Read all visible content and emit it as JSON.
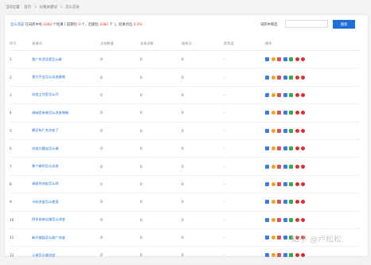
{
  "breadcrumb": {
    "items": [
      "当前位置：",
      "首页",
      "长尾关键词",
      "怎么凉皮"
    ],
    "separator": ">"
  },
  "summary": {
    "prefix": "怎么凉皮",
    "text1": " 在词库中有 ",
    "total": "4382",
    "text2": " 个结果 [ 前期包 ",
    "front": "0",
    "text3": " 个，后期包 ",
    "back": "4382",
    "text4": " 个 ]，结果点位 ",
    "rate": "0.0%"
  },
  "filter": {
    "label": "词库中筛选",
    "placeholder": "",
    "button_label": "搜索"
  },
  "columns": [
    "序号",
    "关键词",
    "文档数量",
    "长尾词数",
    "相关词",
    "竞争度",
    "操作"
  ],
  "rows": [
    {
      "no": "1",
      "keyword": "我广东西北套怎么做",
      "a": "0",
      "b": "0",
      "c": "0",
      "d": "-"
    },
    {
      "no": "2",
      "keyword": "我大平台怎么凉皮做做",
      "a": "0",
      "b": "0",
      "c": "0",
      "d": "-"
    },
    {
      "no": "3",
      "keyword": "凉皮工作室怎么开",
      "a": "0",
      "b": "0",
      "c": "0",
      "d": "-"
    },
    {
      "no": "4",
      "keyword": "调味西来做怎么凉皮做做",
      "a": "0",
      "b": "0",
      "c": "0",
      "d": "-"
    },
    {
      "no": "5",
      "keyword": "最近有广东凉皮了",
      "a": "0",
      "b": "0",
      "c": "0",
      "d": "-"
    },
    {
      "no": "6",
      "keyword": "凉皮分量该怎么做",
      "a": "0",
      "b": "0",
      "c": "0",
      "d": "-"
    },
    {
      "no": "7",
      "keyword": "哪个做的怎么凉皮",
      "a": "0",
      "b": "0",
      "c": "0",
      "d": "-"
    },
    {
      "no": "8",
      "keyword": "调面剂凉皮怎么样",
      "a": "0",
      "b": "0",
      "c": "0",
      "d": "-"
    },
    {
      "no": "9",
      "keyword": "卡料凉皮怎么使用",
      "a": "0",
      "b": "0",
      "c": "0",
      "d": "-"
    },
    {
      "no": "10",
      "keyword": "拼多多新店铺怎么凉皮",
      "a": "0",
      "b": "0",
      "c": "0",
      "d": "-"
    },
    {
      "no": "11",
      "keyword": "新开铺面怎么做广凉皮",
      "a": "0",
      "b": "0",
      "c": "0",
      "d": "-"
    },
    {
      "no": "12",
      "keyword": "小调怎么做凉皮",
      "a": "0",
      "b": "0",
      "c": "0",
      "d": "-"
    }
  ],
  "ops_icons": [
    {
      "name": "home-icon",
      "color": "#3b7de0",
      "round": false
    },
    {
      "name": "refresh-icon",
      "color": "#f0a020",
      "round": true
    },
    {
      "name": "record-icon",
      "color": "#e05050",
      "round": false
    },
    {
      "name": "chart-icon",
      "color": "#3b7de0",
      "round": false
    },
    {
      "name": "link-icon",
      "color": "#3aa84b",
      "round": false
    },
    {
      "name": "delete-icon",
      "color": "#d93030",
      "round": true
    },
    {
      "name": "stop-icon",
      "color": "#d93030",
      "round": true
    }
  ],
  "watermark": "知乎 @卢松松"
}
